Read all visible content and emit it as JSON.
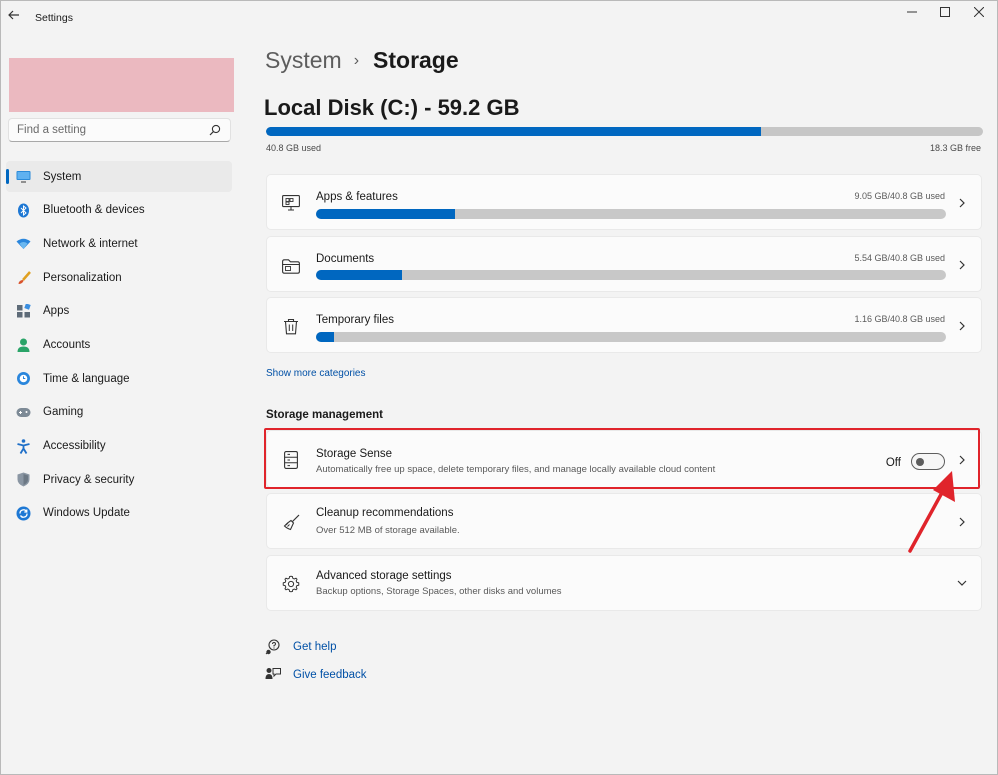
{
  "window": {
    "title": "Settings",
    "minimize_glyph": "─",
    "maximize_glyph": "☐",
    "close_glyph": "✕"
  },
  "sidebar": {
    "search_placeholder": "Find a setting",
    "items": [
      {
        "label": "System",
        "icon": "monitor-icon",
        "active": true
      },
      {
        "label": "Bluetooth & devices",
        "icon": "bluetooth-icon"
      },
      {
        "label": "Network & internet",
        "icon": "wifi-icon"
      },
      {
        "label": "Personalization",
        "icon": "brush-icon"
      },
      {
        "label": "Apps",
        "icon": "apps-icon"
      },
      {
        "label": "Accounts",
        "icon": "person-icon"
      },
      {
        "label": "Time & language",
        "icon": "globe-clock-icon"
      },
      {
        "label": "Gaming",
        "icon": "gamepad-icon"
      },
      {
        "label": "Accessibility",
        "icon": "accessibility-icon"
      },
      {
        "label": "Privacy & security",
        "icon": "shield-icon"
      },
      {
        "label": "Windows Update",
        "icon": "update-icon"
      }
    ]
  },
  "breadcrumb": {
    "parent": "System",
    "separator": "›",
    "current": "Storage"
  },
  "disk": {
    "title": "Local Disk (C:) - 59.2 GB",
    "used_label": "40.8 GB used",
    "free_label": "18.3 GB free",
    "used_fraction": 0.69
  },
  "categories": [
    {
      "label": "Apps & features",
      "usage": "9.05 GB/40.8 GB used",
      "fraction": 0.22,
      "icon": "apps-features-icon"
    },
    {
      "label": "Documents",
      "usage": "5.54 GB/40.8 GB used",
      "fraction": 0.136,
      "icon": "folder-icon"
    },
    {
      "label": "Temporary files",
      "usage": "1.16 GB/40.8 GB used",
      "fraction": 0.028,
      "icon": "trash-icon"
    }
  ],
  "show_more": "Show more categories",
  "storage_management": {
    "title": "Storage management",
    "storage_sense": {
      "label": "Storage Sense",
      "description": "Automatically free up space, delete temporary files, and manage locally available cloud content",
      "toggle_state": "Off"
    },
    "cleanup": {
      "label": "Cleanup recommendations",
      "description": "Over 512 MB of storage available."
    },
    "advanced": {
      "label": "Advanced storage settings",
      "description": "Backup options, Storage Spaces, other disks and volumes"
    }
  },
  "help": {
    "get_help": "Get help",
    "give_feedback": "Give feedback"
  },
  "colors": {
    "accent": "#0067c0",
    "highlight": "#e0242b",
    "link": "#0050a6"
  }
}
